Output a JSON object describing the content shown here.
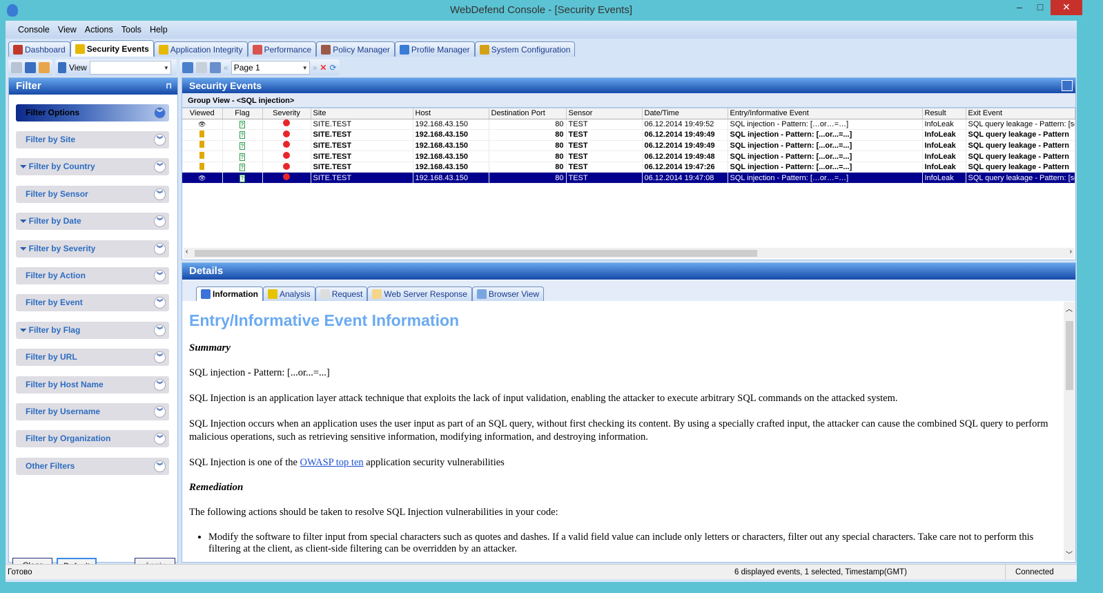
{
  "window": {
    "title": "WebDefend Console - [Security Events]",
    "minimize": "–",
    "maximize": "□",
    "close": "✕"
  },
  "menu": [
    "Console",
    "View",
    "Actions",
    "Tools",
    "Help"
  ],
  "tabs": [
    {
      "label": "Dashboard",
      "color": "#c0392b"
    },
    {
      "label": "Security Events",
      "color": "#e6b800"
    },
    {
      "label": "Application Integrity",
      "color": "#e6b800"
    },
    {
      "label": "Performance",
      "color": "#d9534f"
    },
    {
      "label": "Policy Manager",
      "color": "#9b5a4a"
    },
    {
      "label": "Profile Manager",
      "color": "#3a7bd5"
    },
    {
      "label": "System Configuration",
      "color": "#d4a017"
    }
  ],
  "toolbar": {
    "view_label": "View",
    "view_value": "",
    "page_value": "Page 1"
  },
  "filter": {
    "title": "Filter",
    "pin": "⊓",
    "options_label": "Filter Options",
    "items": [
      "Filter by Site",
      "Filter by Country",
      "Filter by Sensor",
      "Filter by Date",
      "Filter by Severity",
      "Filter by Action",
      "Filter by Event",
      "Filter by Flag",
      "Filter by URL",
      "Filter by Host Name",
      "Filter by Username",
      "Filter by Organization",
      "Other Filters"
    ],
    "active_filters": [
      false,
      true,
      false,
      true,
      true,
      false,
      false,
      true,
      false,
      false,
      false,
      false,
      false
    ],
    "clear": "Clear",
    "default": "Default",
    "apply": "Apply"
  },
  "events": {
    "title": "Security Events",
    "group_view": "Group View - <SQL injection>",
    "columns": [
      "Viewed",
      "Flag",
      "Severity",
      "Site",
      "Host",
      "Destination Port",
      "Sensor",
      "Date/Time",
      "Entry/Informative Event",
      "Result",
      "Exit Event"
    ],
    "rows": [
      {
        "viewed": "eye",
        "site": "SITE.TEST",
        "host": "192.168.43.150",
        "port": "80",
        "sensor": "TEST",
        "datetime": "06.12.2014 19:49:52",
        "entry": "SQL injection - Pattern: […or…=…]",
        "result": "InfoLeak",
        "exit": "SQL query leakage - Pattern: [se",
        "bold": false,
        "selected": false
      },
      {
        "viewed": "note",
        "site": "SITE.TEST",
        "host": "192.168.43.150",
        "port": "80",
        "sensor": "TEST",
        "datetime": "06.12.2014 19:49:49",
        "entry": "SQL injection - Pattern: [...or...=...]",
        "result": "InfoLeak",
        "exit": "SQL query leakage - Pattern",
        "bold": true,
        "selected": false
      },
      {
        "viewed": "note",
        "site": "SITE.TEST",
        "host": "192.168.43.150",
        "port": "80",
        "sensor": "TEST",
        "datetime": "06.12.2014 19:49:49",
        "entry": "SQL injection - Pattern: [...or...=...]",
        "result": "InfoLeak",
        "exit": "SQL query leakage - Pattern",
        "bold": true,
        "selected": false
      },
      {
        "viewed": "note",
        "site": "SITE.TEST",
        "host": "192.168.43.150",
        "port": "80",
        "sensor": "TEST",
        "datetime": "06.12.2014 19:49:48",
        "entry": "SQL injection - Pattern: [...or...=...]",
        "result": "InfoLeak",
        "exit": "SQL query leakage - Pattern",
        "bold": true,
        "selected": false
      },
      {
        "viewed": "note",
        "site": "SITE.TEST",
        "host": "192.168.43.150",
        "port": "80",
        "sensor": "TEST",
        "datetime": "06.12.2014 19:47:26",
        "entry": "SQL injection - Pattern: [...or...=...]",
        "result": "InfoLeak",
        "exit": "SQL query leakage - Pattern",
        "bold": true,
        "selected": false
      },
      {
        "viewed": "eye",
        "site": "SITE.TEST",
        "host": "192.168.43.150",
        "port": "80",
        "sensor": "TEST",
        "datetime": "06.12.2014 19:47:08",
        "entry": "SQL injection - Pattern: […or…=…]",
        "result": "InfoLeak",
        "exit": "SQL query leakage - Pattern: [se",
        "bold": false,
        "selected": true
      }
    ]
  },
  "details": {
    "title": "Details",
    "tabs": [
      {
        "label": "Information",
        "color": "#3b73d8"
      },
      {
        "label": "Analysis",
        "color": "#e6c200"
      },
      {
        "label": "Request",
        "color": "#dddddd"
      },
      {
        "label": "Web Server Response",
        "color": "#f5d58a"
      },
      {
        "label": "Browser View",
        "color": "#7aa6e0"
      }
    ],
    "heading": "Entry/Informative Event Information",
    "summary_heading": "Summary",
    "summary": "SQL injection - Pattern: [...or...=...]",
    "p1": "SQL Injection is an application layer attack technique that exploits the lack of input validation, enabling the attacker to execute arbitrary SQL commands on the attacked system.",
    "p2": "SQL Injection occurs when an application uses the user input as part of an SQL query, without first checking its content. By using a specially crafted input, the attacker can cause the combined SQL query to perform malicious operations, such as retrieving sensitive information, modifying information, and destroying information.",
    "p3_before": "SQL Injection is one of the ",
    "p3_link": "OWASP top ten",
    "p3_after": " application security vulnerabilities",
    "remediation_heading": "Remediation",
    "p4": "The following actions should be taken to resolve SQL Injection vulnerabilities in your code:",
    "bullet1": "Modify the software to filter input from special characters such as quotes and dashes. If a valid field value can include only letters or characters, filter out any special characters. Take care not to perform this filtering at the client, as client-side filtering can be overridden by an attacker."
  },
  "status": {
    "left": "Готово",
    "middle": "6 displayed events, 1 selected, Timestamp(GMT)",
    "right": "Connected"
  }
}
